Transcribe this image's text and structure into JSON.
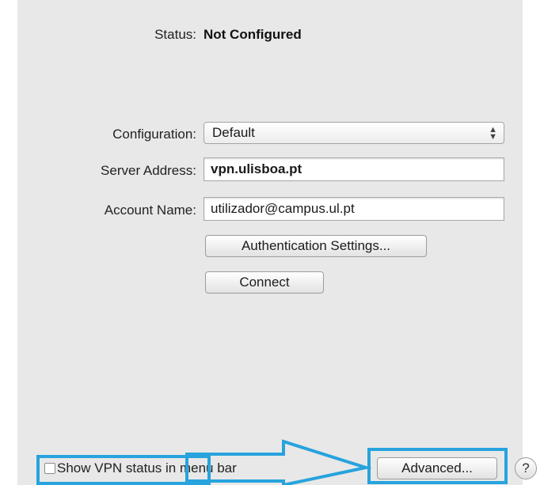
{
  "status": {
    "label": "Status:",
    "value": "Not Configured"
  },
  "form": {
    "configuration_label": "Configuration:",
    "configuration_value": "Default",
    "server_address_label": "Server Address:",
    "server_address_value": "vpn.ulisboa.pt",
    "account_name_label": "Account Name:",
    "account_name_value": "utilizador@campus.ul.pt"
  },
  "buttons": {
    "authentication_settings": "Authentication Settings...",
    "connect": "Connect",
    "advanced": "Advanced...",
    "help": "?"
  },
  "footer": {
    "show_vpn_status_label": "Show VPN status in menu bar",
    "show_vpn_status_checked": false
  },
  "annotation": {
    "color": "#27a3dd"
  }
}
